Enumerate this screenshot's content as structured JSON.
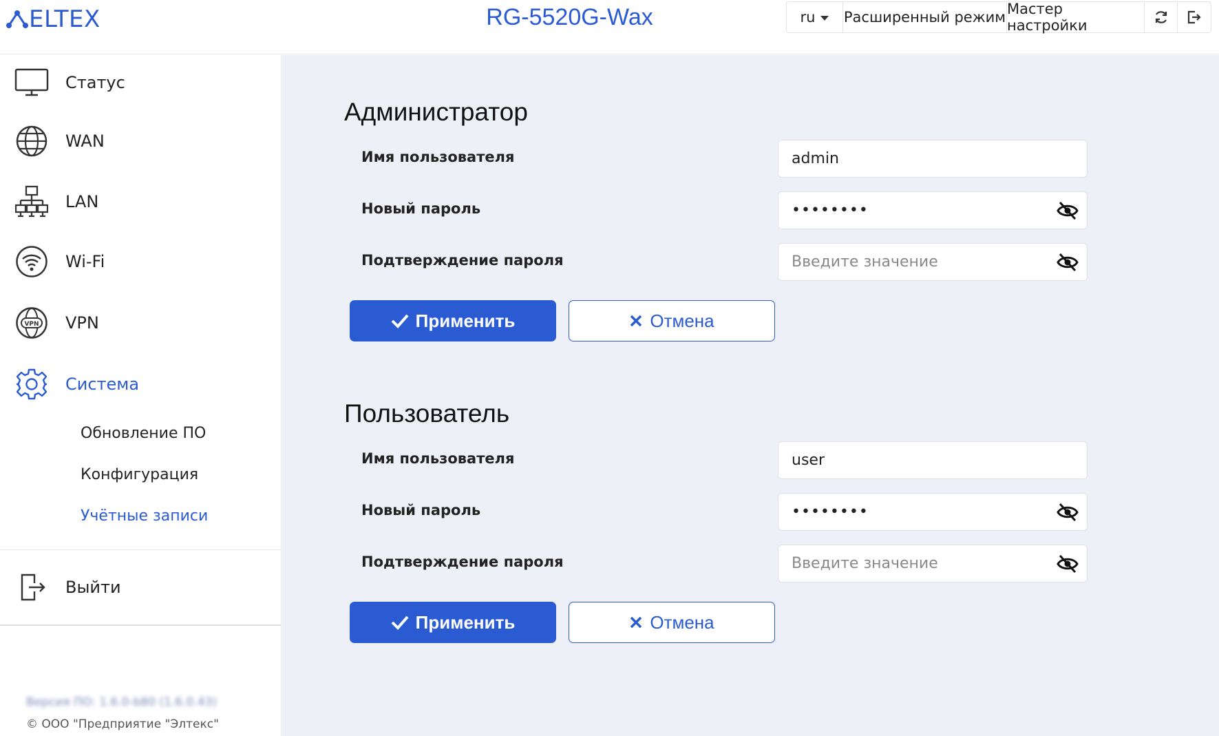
{
  "brand": {
    "logo_text": "ELTEX",
    "accent_color": "#2b5bd3"
  },
  "header": {
    "device_title": "RG-5520G-Wax",
    "lang": "ru",
    "advanced_mode": "Расширенный режим",
    "setup_wizard": "Мастер настройки",
    "refresh_icon": "refresh-icon",
    "logout_icon": "logout-icon"
  },
  "sidebar": {
    "items": [
      {
        "label": "Статус",
        "icon": "monitor-icon"
      },
      {
        "label": "WAN",
        "icon": "globe-icon"
      },
      {
        "label": "LAN",
        "icon": "network-icon"
      },
      {
        "label": "Wi-Fi",
        "icon": "wifi-icon"
      },
      {
        "label": "VPN",
        "icon": "vpn-icon"
      },
      {
        "label": "Система",
        "icon": "gear-icon",
        "active": true
      }
    ],
    "sub_items": [
      {
        "label": "Обновление ПО"
      },
      {
        "label": "Конфигурация"
      },
      {
        "label": "Учётные записи",
        "active": true
      }
    ],
    "logout": {
      "label": "Выйти",
      "icon": "exit-icon"
    },
    "version": "Версия ПО: 1.6.0-b80 (1.6.0.43)",
    "copyright": "© ООО \"Предприятие \"Элтекс\""
  },
  "admin": {
    "title": "Администратор",
    "username_label": "Имя пользователя",
    "username_value": "admin",
    "new_password_label": "Новый пароль",
    "new_password_value": "••••••••",
    "confirm_label": "Подтверждение пароля",
    "confirm_placeholder": "Введите значение",
    "apply": "Применить",
    "cancel": "Отмена"
  },
  "user": {
    "title": "Пользователь",
    "username_label": "Имя пользователя",
    "username_value": "user",
    "new_password_label": "Новый пароль",
    "new_password_value": "••••••••",
    "confirm_label": "Подтверждение пароля",
    "confirm_placeholder": "Введите значение",
    "apply": "Применить",
    "cancel": "Отмена"
  }
}
